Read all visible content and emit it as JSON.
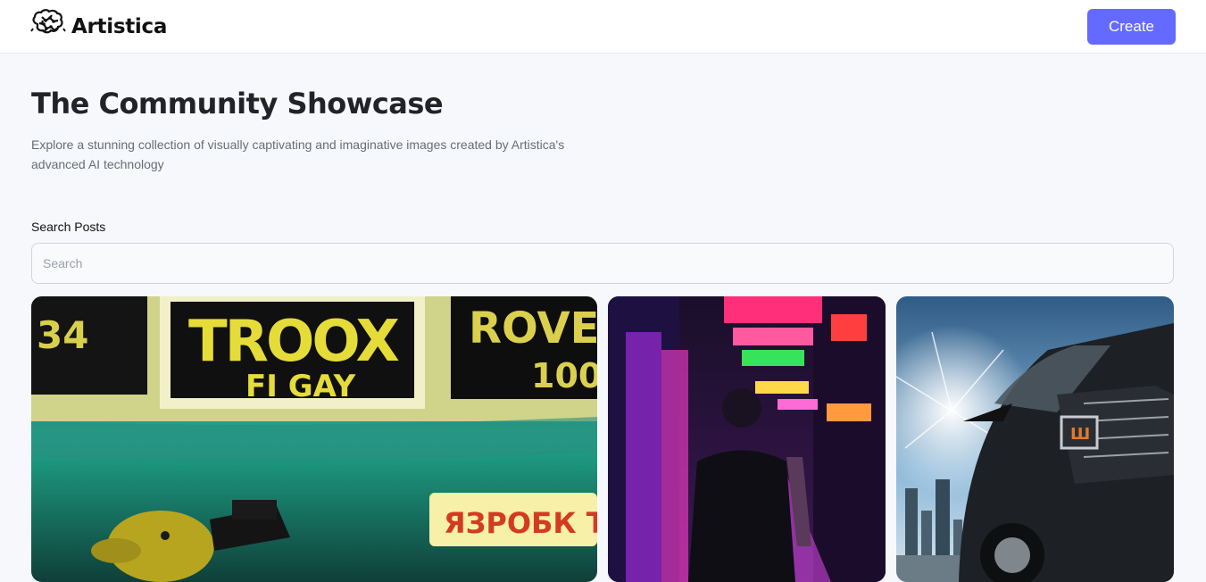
{
  "header": {
    "brand": "Artistica",
    "create_label": "Create"
  },
  "hero": {
    "title": "The Community Showcase",
    "subtitle": "Explore a stunning collection of visually captivating and imaginative images created by Artistica's advanced AI technology"
  },
  "search": {
    "label": "Search Posts",
    "placeholder": "Search",
    "value": ""
  },
  "posts": [
    {
      "sign_top_left": "34",
      "sign_main": "TROOX",
      "sign_sub": "FI GAY",
      "sign_right": "ROVE",
      "sign_right_num": "100",
      "sign_bottom": "ЯЗРОБК ТО"
    },
    {},
    {
      "badge": "Ш"
    }
  ],
  "colors": {
    "accent": "#6469ff",
    "background": "#f7f8fc"
  },
  "icons": {
    "logo": "brain-icon"
  }
}
